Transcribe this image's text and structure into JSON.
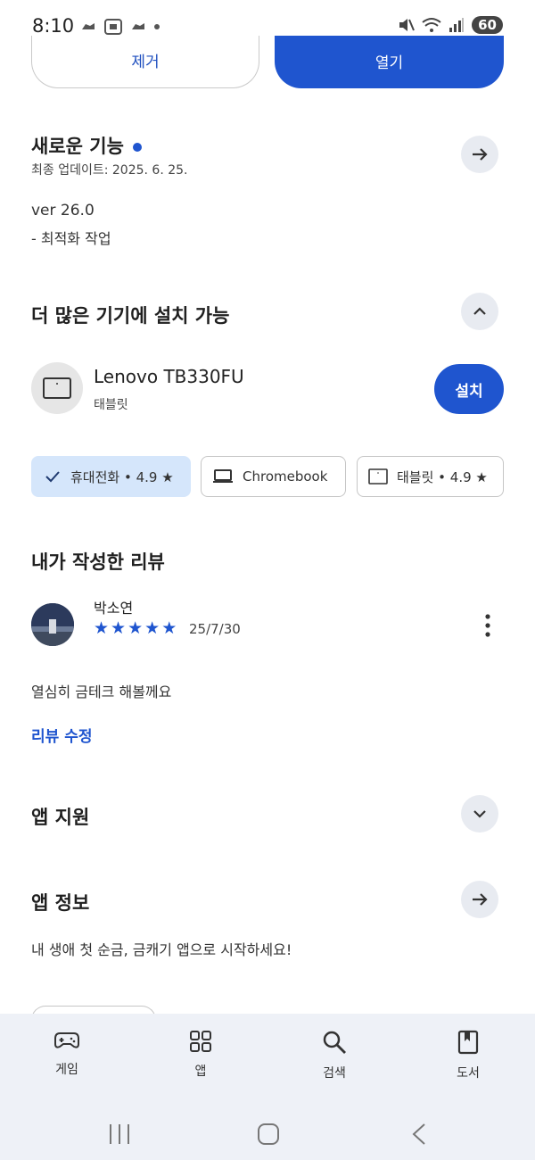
{
  "status_bar": {
    "time": "8:10",
    "battery": "60"
  },
  "actions": {
    "remove": "제거",
    "open": "열기"
  },
  "whats_new": {
    "title": "새로운 기능",
    "updated": "최종 업데이트: 2025. 6. 25.",
    "version": "ver 26.0",
    "note": "- 최적화 작업"
  },
  "more_devices": {
    "title": "더 많은 기기에 설치 가능",
    "device_name": "Lenovo TB330FU",
    "device_type": "태블릿",
    "install": "설치"
  },
  "chips": [
    {
      "label": "휴대전화 • 4.9 ★",
      "selected": true
    },
    {
      "label": "Chromebook",
      "selected": false
    },
    {
      "label": "태블릿 • 4.9 ★",
      "selected": false
    }
  ],
  "my_review": {
    "title": "내가 작성한 리뷰",
    "author": "박소연",
    "rating": 5,
    "date": "25/7/30",
    "text": "열심히 금테크 해볼께요",
    "edit_link": "리뷰 수정"
  },
  "app_support": {
    "title": "앱 지원"
  },
  "app_info": {
    "title": "앱 정보",
    "description": "내 생애 첫 순금, 금캐기 앱으로 시작하세요!"
  },
  "bottom_nav": [
    {
      "label": "게임",
      "icon": "gamepad-icon"
    },
    {
      "label": "앱",
      "icon": "apps-grid-icon"
    },
    {
      "label": "검색",
      "icon": "search-icon"
    },
    {
      "label": "도서",
      "icon": "book-icon"
    }
  ],
  "colors": {
    "accent": "#1f55cf",
    "chip_selected_bg": "#d5e6fb",
    "nav_bg": "#eef1f7"
  }
}
